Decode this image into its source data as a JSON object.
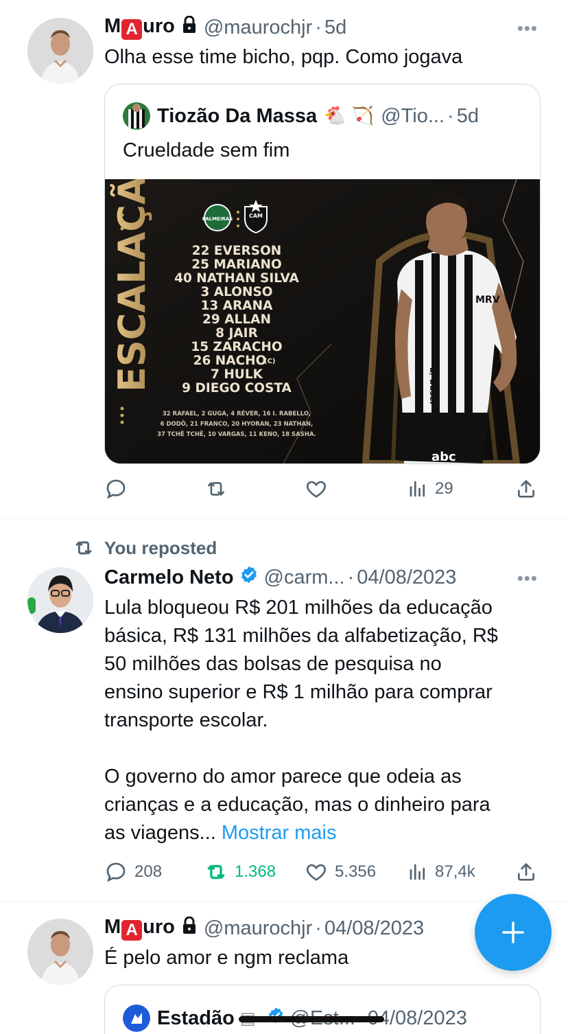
{
  "tweets": [
    {
      "author": {
        "name_pre": "M",
        "name_badge": "A",
        "name_post": "uro",
        "lock_icon": "lock-icon",
        "handle": "@maurochjr",
        "time": "5d"
      },
      "text": "Olha esse time bicho, pqp. Como jogava",
      "more": "•••",
      "quote": {
        "author": {
          "name": "Tiozão Da Massa",
          "emoji": "🐔 🏹",
          "handle": "@Tio...",
          "time": "5d"
        },
        "text": "Crueldade sem fim",
        "image": {
          "title": "ESCALAÇÃO",
          "starters": [
            "22 EVERSON",
            "25 MARIANO",
            "40 NATHAN SILVA",
            "3 ALONSO",
            "13 ARANA",
            "29 ALLAN",
            "8 JAIR",
            "15 ZARACHO",
            "26 NACHO",
            "7 HULK",
            "9 DIEGO COSTA"
          ],
          "captain_mark": "(C)",
          "bench": [
            "32 RAFAEL, 2 GUGA, 4 RÉVER, 16 I. RABELLO,",
            "6 DODÔ, 21 FRANCO, 20 HYORAN, 23 NATHAN,",
            "37 TCHÊ TCHÊ, 10 VARGAS, 11 KENO, 18 SASHA."
          ],
          "club_badge_left": "PALMEIRAS",
          "club_badge_right": "CAM",
          "shirt_text": [
            "MRV",
            "b/ buser",
            "abc"
          ]
        }
      },
      "stats": {
        "views": "29"
      }
    },
    {
      "repost_label": "You reposted",
      "author": {
        "name": "Carmelo Neto",
        "handle": "@carm...",
        "time": "04/08/2023"
      },
      "more": "•••",
      "text_lines": [
        "Lula bloqueou R$ 201 milhões da educação",
        "básica, R$ 131 milhões da alfabetização, R$",
        "50 milhões das bolsas de pesquisa no",
        "ensino superior e R$ 1 milhão para comprar",
        "transporte escolar."
      ],
      "text_lines_2": [
        "O governo do amor parece que odeia as",
        "crianças e a educação, mas o dinheiro para"
      ],
      "text_last": "as viagens... ",
      "show_more": "Mostrar mais",
      "stats": {
        "replies": "208",
        "reposts": "1.368",
        "likes": "5.356",
        "views": "87,4k"
      }
    },
    {
      "author": {
        "name_pre": "M",
        "name_badge": "A",
        "name_post": "uro",
        "handle": "@maurochjr",
        "time": "04/08/2023"
      },
      "text": "É pelo amor e ngm reclama",
      "quote": {
        "author": {
          "name": "Estadão",
          "handle": "@Est...",
          "time": "04/08/2023"
        }
      }
    }
  ],
  "fab": {
    "label": "+"
  },
  "colors": {
    "accent": "#1d9bf0",
    "repost_green": "#00ba7c",
    "secondary_text": "#536471",
    "badge_red": "#e0252f"
  }
}
